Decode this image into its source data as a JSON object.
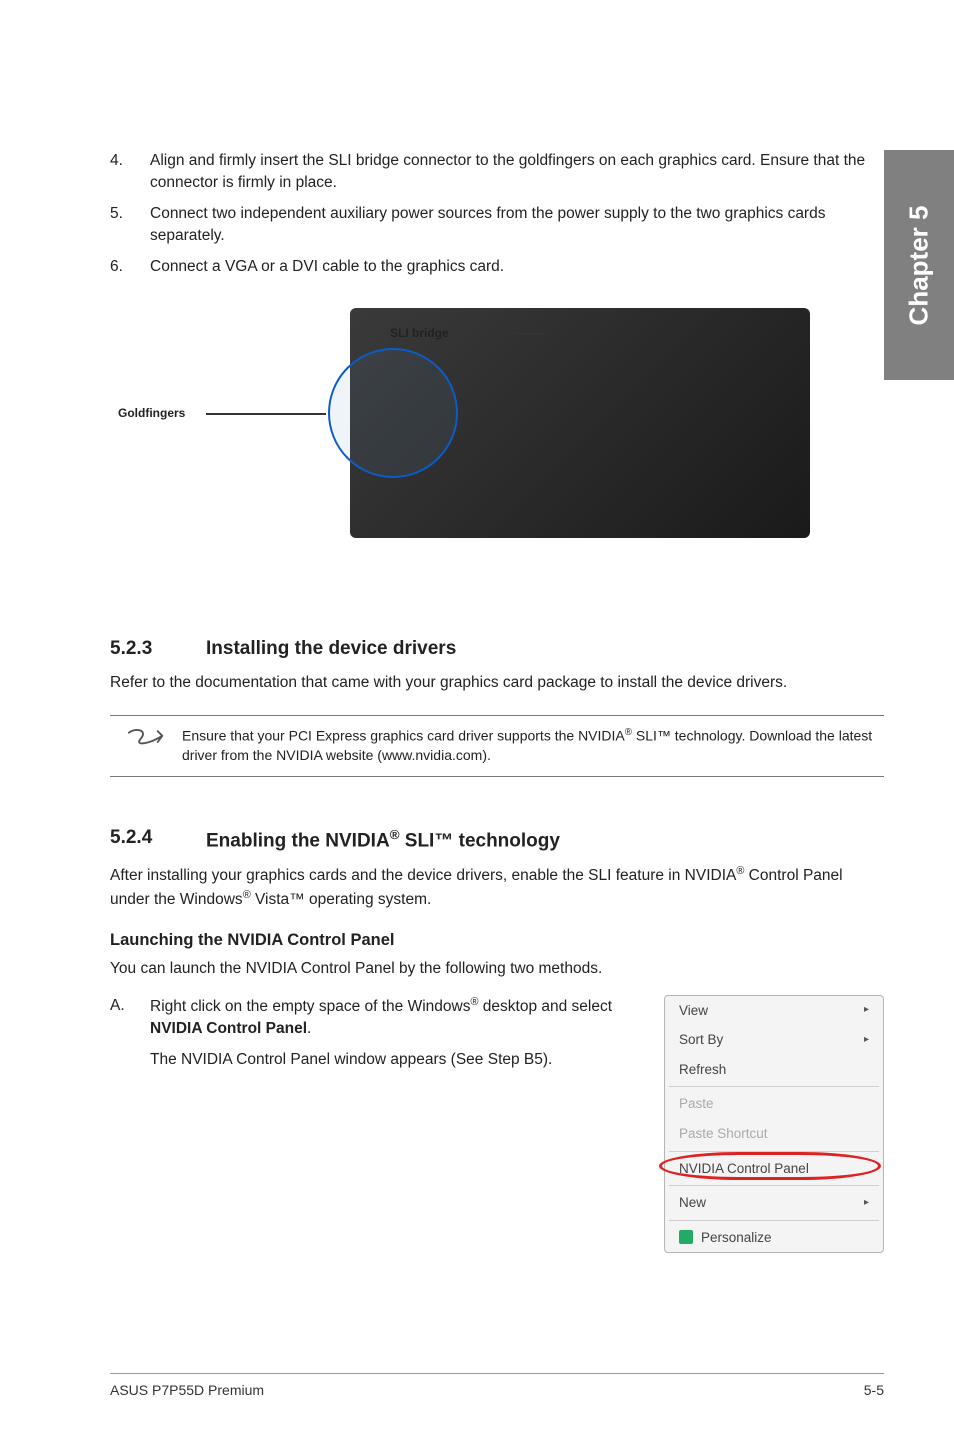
{
  "sideTab": "Chapter 5",
  "steps": [
    {
      "num": "4.",
      "text": "Align and firmly insert the SLI bridge connector to the goldfingers on each graphics card. Ensure that the connector is firmly in place."
    },
    {
      "num": "5.",
      "text": "Connect two independent auxiliary power sources from the power supply to the two graphics cards separately."
    },
    {
      "num": "6.",
      "text": "Connect a VGA or a DVI cable to the graphics card."
    }
  ],
  "fig": {
    "sli": "SLI bridge",
    "gold": "Goldfingers"
  },
  "sect523": {
    "no": "5.2.3",
    "title": "Installing the device drivers",
    "body": "Refer to the documentation that came with your graphics card package to install the device drivers."
  },
  "note": {
    "pre": "Ensure that your PCI Express graphics card driver supports the NVIDIA",
    "reg": "®",
    "mid": " SLI™ technology. Download the latest driver from the NVIDIA website (www.nvidia.com)."
  },
  "sect524": {
    "no": "5.2.4",
    "titlePre": "Enabling the NVIDIA",
    "reg": "®",
    "titlePost": " SLI™ technology",
    "body1a": "After installing your graphics cards and the device drivers, enable the SLI feature in NVIDIA",
    "reg2": "®",
    "body1b": " Control Panel under the Windows",
    "reg3": "®",
    "body1c": " Vista™ operating system."
  },
  "subhead": "Launching the NVIDIA Control Panel",
  "subbody": "You can launch the NVIDIA Control Panel by the following two methods.",
  "methodA": {
    "letter": "A.",
    "line1a": "Right click on the empty space of the Windows",
    "reg": "®",
    "line1b": " desktop and select ",
    "bold": "NVIDIA Control Panel",
    "line1c": ".",
    "line2": "The NVIDIA Control Panel window appears (See Step B5)."
  },
  "ctx": {
    "view": "View",
    "sortby": "Sort By",
    "refresh": "Refresh",
    "paste": "Paste",
    "pasteShortcut": "Paste Shortcut",
    "nvidia": "NVIDIA Control Panel",
    "new": "New",
    "personalize": "Personalize"
  },
  "footer": {
    "left": "ASUS P7P55D Premium",
    "right": "5-5"
  }
}
